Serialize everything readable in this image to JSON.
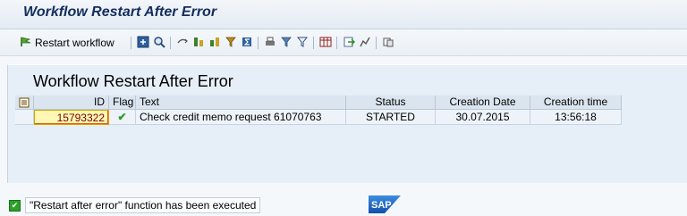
{
  "window": {
    "title": "Workflow Restart After Error"
  },
  "toolbar": {
    "restart_label": "Restart workflow",
    "icons": [
      "details-icon",
      "find-icon",
      "refresh-icon",
      "sort-ascending-icon",
      "sort-descending-icon",
      "set-filter-icon",
      "sum-icon",
      "print-icon",
      "filter-icon",
      "filter-remove-icon",
      "layout-icon",
      "export-icon",
      "graphic-icon",
      "abc-analysis-icon"
    ]
  },
  "alv": {
    "title": "Workflow Restart After Error",
    "columns": [
      "ID",
      "Flag",
      "Text",
      "Status",
      "Creation Date",
      "Creation time"
    ],
    "rows": [
      {
        "id": "15793322",
        "flag": "✔",
        "text": "Check credit memo request 61070763",
        "status": "STARTED",
        "date": "30.07.2015",
        "time": "13:56:18"
      }
    ]
  },
  "statusbar": {
    "message": "\"Restart after error\" function has been executed",
    "type": "success"
  },
  "colors": {
    "accent": "#132d5e",
    "success": "#2aa12a",
    "id_highlight": "#fff7b3"
  }
}
